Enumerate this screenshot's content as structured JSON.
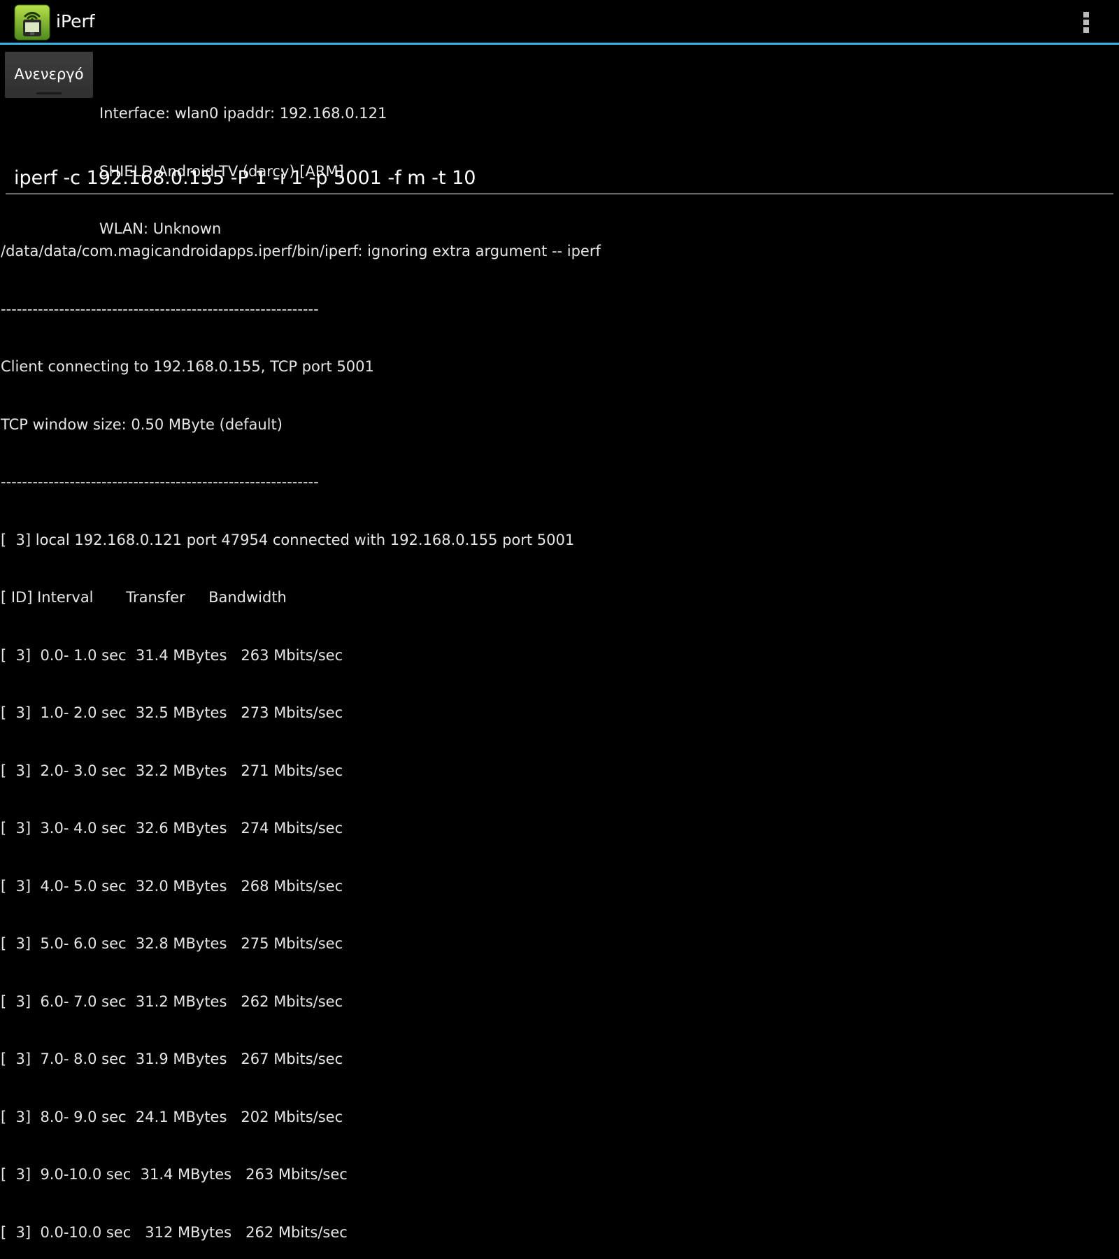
{
  "action_bar": {
    "title": "iPerf",
    "icon": "iperf-app-icon",
    "menu_icon": "overflow-menu-icon",
    "accent_color": "#33b5e5"
  },
  "toggle": {
    "label": "Ανενεργό"
  },
  "device_info": [
    "Interface: wlan0 ipaddr: 192.168.0.121",
    "SHIELD Android TV (darcy) [ARM]",
    "WLAN: Unknown"
  ],
  "command": {
    "value": "iperf -c 192.168.0.155 -P 1 -i 1 -p 5001 -f m -t 10"
  },
  "output_lines": [
    "/data/data/com.magicandroidapps.iperf/bin/iperf: ignoring extra argument -- iperf",
    "------------------------------------------------------------",
    "Client connecting to 192.168.0.155, TCP port 5001",
    "TCP window size: 0.50 MByte (default)",
    "------------------------------------------------------------",
    "[  3] local 192.168.0.121 port 47954 connected with 192.168.0.155 port 5001",
    "[ ID] Interval       Transfer     Bandwidth",
    "[  3]  0.0- 1.0 sec  31.4 MBytes   263 Mbits/sec",
    "[  3]  1.0- 2.0 sec  32.5 MBytes   273 Mbits/sec",
    "[  3]  2.0- 3.0 sec  32.2 MBytes   271 Mbits/sec",
    "[  3]  3.0- 4.0 sec  32.6 MBytes   274 Mbits/sec",
    "[  3]  4.0- 5.0 sec  32.0 MBytes   268 Mbits/sec",
    "[  3]  5.0- 6.0 sec  32.8 MBytes   275 Mbits/sec",
    "[  3]  6.0- 7.0 sec  31.2 MBytes   262 Mbits/sec",
    "[  3]  7.0- 8.0 sec  31.9 MBytes   267 Mbits/sec",
    "[  3]  8.0- 9.0 sec  24.1 MBytes   202 Mbits/sec",
    "[  3]  9.0-10.0 sec  31.4 MBytes   263 Mbits/sec",
    "[  3]  0.0-10.0 sec   312 MBytes   262 Mbits/sec"
  ]
}
